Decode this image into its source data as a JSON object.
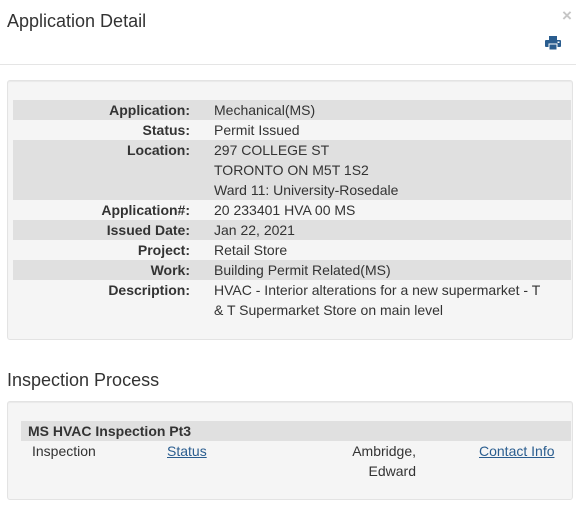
{
  "modal": {
    "title": "Application Detail",
    "close_glyph": "×",
    "print_icon": "print-icon"
  },
  "application": {
    "rows": [
      {
        "label": "Application:",
        "lines": [
          "Mechanical(MS)"
        ]
      },
      {
        "label": "Status:",
        "lines": [
          "Permit Issued"
        ]
      },
      {
        "label": "Location:",
        "lines": [
          "297 COLLEGE ST",
          "TORONTO ON M5T 1S2",
          "Ward 11: University-Rosedale"
        ]
      },
      {
        "label": "Application#:",
        "lines": [
          "20 233401 HVA 00 MS"
        ]
      },
      {
        "label": "Issued Date:",
        "lines": [
          "Jan 22, 2021"
        ]
      },
      {
        "label": "Project:",
        "lines": [
          "Retail Store"
        ]
      },
      {
        "label": "Work:",
        "lines": [
          "Building Permit Related(MS)"
        ]
      },
      {
        "label": "Description:",
        "lines": [
          "HVAC - Interior alterations for a new supermarket - T",
          "& T Supermarket Store on main level"
        ]
      }
    ]
  },
  "inspection": {
    "section_title": "Inspection Process",
    "group_title": "MS HVAC Inspection Pt3",
    "rows": [
      {
        "type": "Inspection",
        "status_link": "Status",
        "inspector": [
          "Ambridge,",
          "Edward"
        ],
        "contact_link": "Contact Info"
      }
    ]
  },
  "colors": {
    "row_shade": "#e0e0e0",
    "well_bg": "#f5f5f5",
    "link": "#2a5d8f",
    "text": "#333333"
  }
}
